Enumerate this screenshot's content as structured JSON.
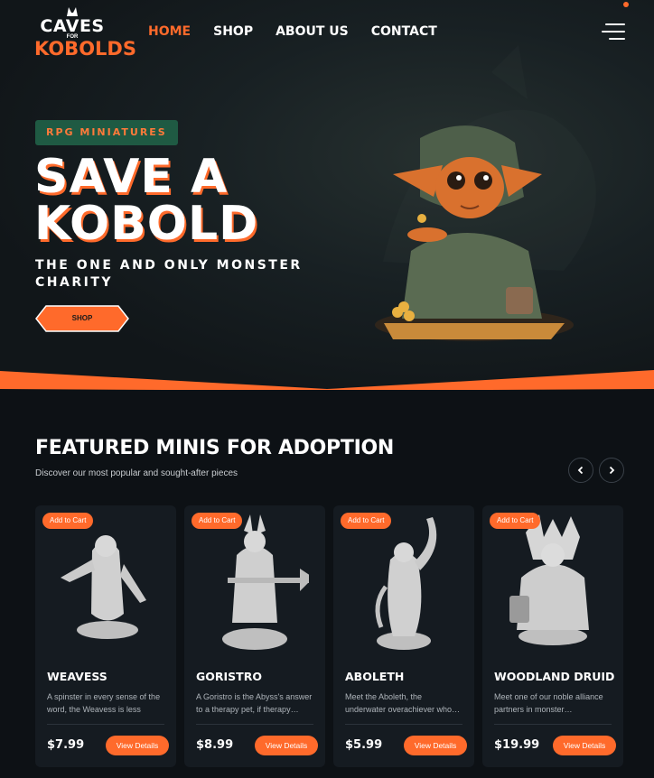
{
  "brand": {
    "logo_top": "CAVES",
    "logo_mid": "FOR",
    "logo_bottom": "KOBOLDS",
    "accent": "#ff6a2b",
    "badge_green": "#1f5a43"
  },
  "nav": {
    "items": [
      {
        "label": "HOME",
        "active": true
      },
      {
        "label": "SHOP",
        "active": false
      },
      {
        "label": "ABOUT US",
        "active": false
      },
      {
        "label": "CONTACT",
        "active": false
      }
    ],
    "menu_icon": "hamburger-icon"
  },
  "hero": {
    "badge": "RPG MINIATURES",
    "title_line1": "SAVE A",
    "title_line2": "KOBOLD",
    "subtitle": "THE ONE AND ONLY MONSTER CHARITY",
    "cta": "SHOP"
  },
  "featured": {
    "title": "FEATURED MINIS FOR ADOPTION",
    "subtitle": "Discover our most popular and sought-after pieces",
    "prev_icon": "chevron-left-icon",
    "next_icon": "chevron-right-icon",
    "products": [
      {
        "name": "WEAVESS",
        "description": "A spinster in every sense of the word, the Weavess is less abou…",
        "price": "$7.99",
        "add_label": "Add to Cart",
        "details_label": "View Details"
      },
      {
        "name": "GORISTRO",
        "description": "A Goristro is the Abyss's answer to a therapy pet, if therapy…",
        "price": "$8.99",
        "add_label": "Add to Cart",
        "details_label": "View Details"
      },
      {
        "name": "ABOLETH",
        "description": "Meet the Aboleth, the underwater overachiever who…",
        "price": "$5.99",
        "add_label": "Add to Cart",
        "details_label": "View Details"
      },
      {
        "name": "WOODLAND DRUID",
        "description": "Meet one of our noble alliance partners in monster…",
        "price": "$19.99",
        "add_label": "Add to Cart",
        "details_label": "View Details"
      }
    ]
  }
}
